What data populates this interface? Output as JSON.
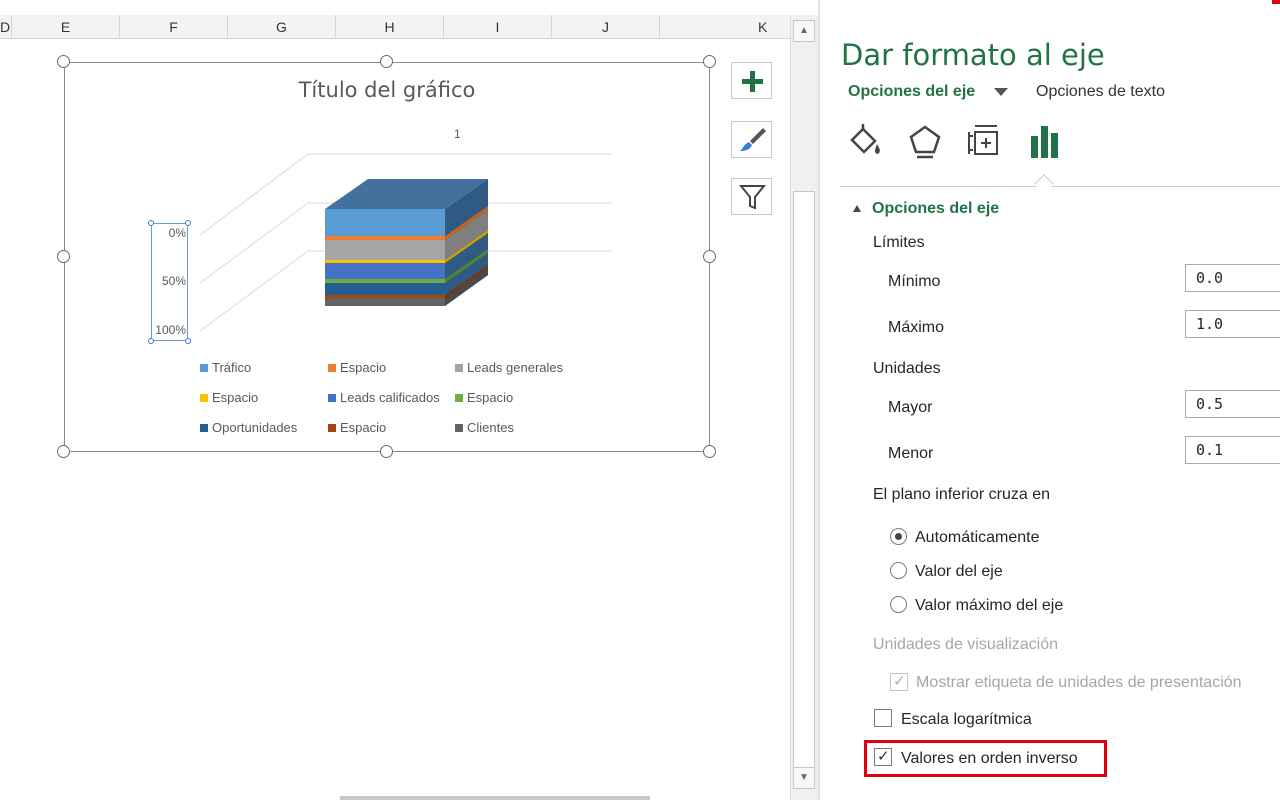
{
  "sheet": {
    "columns": [
      "D",
      "E",
      "F",
      "G",
      "H",
      "I",
      "J",
      "K"
    ]
  },
  "chart": {
    "title": "Título del gráfico",
    "series_category": "1",
    "y_ticks": [
      "0%",
      "50%",
      "100%"
    ],
    "legend": [
      {
        "label": "Tráfico",
        "color": "#5b9bd5"
      },
      {
        "label": "Espacio",
        "color": "#ed7d31"
      },
      {
        "label": "Leads generales",
        "color": "#a5a5a5"
      },
      {
        "label": "Espacio",
        "color": "#ffc000"
      },
      {
        "label": "Leads calificados",
        "color": "#4472c4"
      },
      {
        "label": "Espacio",
        "color": "#70ad47"
      },
      {
        "label": "Oportunidades",
        "color": "#255e91"
      },
      {
        "label": "Espacio",
        "color": "#9e480e"
      },
      {
        "label": "Clientes",
        "color": "#636363"
      }
    ]
  },
  "chart_tools": {
    "add_element": "chart-elements",
    "styles": "chart-styles",
    "filters": "chart-filters"
  },
  "pane": {
    "title": "Dar formato al eje",
    "tab_axis": "Opciones del eje",
    "tab_text": "Opciones de texto",
    "section": "Opciones del eje",
    "limits_label": "Límites",
    "min_label": "Mínimo",
    "min_value": "0.0",
    "max_label": "Máximo",
    "max_value": "1.0",
    "units_label": "Unidades",
    "major_label": "Mayor",
    "major_value": "0.5",
    "minor_label": "Menor",
    "minor_value": "0.1",
    "cross_label": "El plano inferior cruza en",
    "radio_auto": "Automáticamente",
    "radio_value": "Valor del eje",
    "radio_max": "Valor máximo del eje",
    "display_units_label": "Unidades de visualización",
    "show_units_label": "Mostrar etiqueta de unidades de presentación",
    "log_scale_label": "Escala logarítmica",
    "reverse_label": "Valores en orden inverso"
  },
  "colors": {
    "accent": "#217346",
    "highlight": "#e0000f"
  }
}
